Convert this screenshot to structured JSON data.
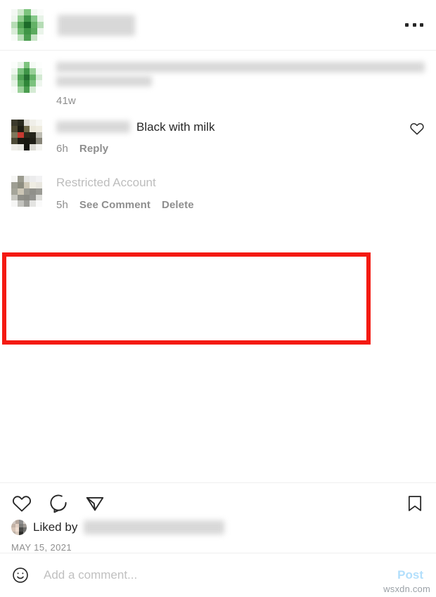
{
  "header": {
    "avatar_name": "user-avatar-green",
    "username_redacted": "",
    "menu_icon": "more-options-icon"
  },
  "caption": {
    "avatar_name": "caption-avatar-green",
    "text_redacted": "",
    "timestamp": "41w"
  },
  "comments": [
    {
      "avatar_name": "commenter-avatar-dark",
      "username_redacted": "",
      "text": "Black with milk",
      "timestamp": "6h",
      "reply_label": "Reply",
      "like_icon": "heart-icon"
    }
  ],
  "restricted_comment": {
    "avatar_name": "restricted-avatar-gray",
    "username": "Restricted Account",
    "timestamp": "5h",
    "see_comment_label": "See Comment",
    "delete_label": "Delete",
    "highlight_color": "#f41a12"
  },
  "actions": {
    "like_icon": "heart-icon",
    "comment_icon": "comment-bubble-icon",
    "share_icon": "share-paperplane-icon",
    "save_icon": "bookmark-icon"
  },
  "likes": {
    "prefix": "Liked by",
    "names_redacted": "",
    "avatar_name": "liker-avatar"
  },
  "post_date": "MAY 15, 2021",
  "add_comment": {
    "emoji_icon": "emoji-smiley-icon",
    "placeholder": "Add a comment...",
    "value": "",
    "post_label": "Post",
    "post_color": "#b2dffc"
  },
  "watermark": "wsxdn.com"
}
